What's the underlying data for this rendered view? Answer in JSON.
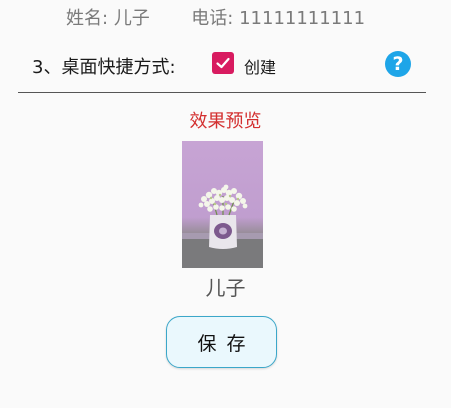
{
  "contact": {
    "name_label": "姓名:",
    "name_value": "儿子",
    "phone_label": "电话:",
    "phone_value": "11111111111"
  },
  "shortcut": {
    "label": "3、桌面快捷方式:",
    "checkbox_label": "创建",
    "checked": true,
    "help_symbol": "?"
  },
  "preview": {
    "title": "效果预览",
    "image_subject": "white flowers in a vase on purple background",
    "name": "儿子"
  },
  "actions": {
    "save_label": "保存"
  },
  "colors": {
    "accent_checkbox": "#d81b60",
    "help_icon": "#1ea5e8",
    "preview_title": "#d32f2f",
    "button_border": "#3ba7c9"
  }
}
